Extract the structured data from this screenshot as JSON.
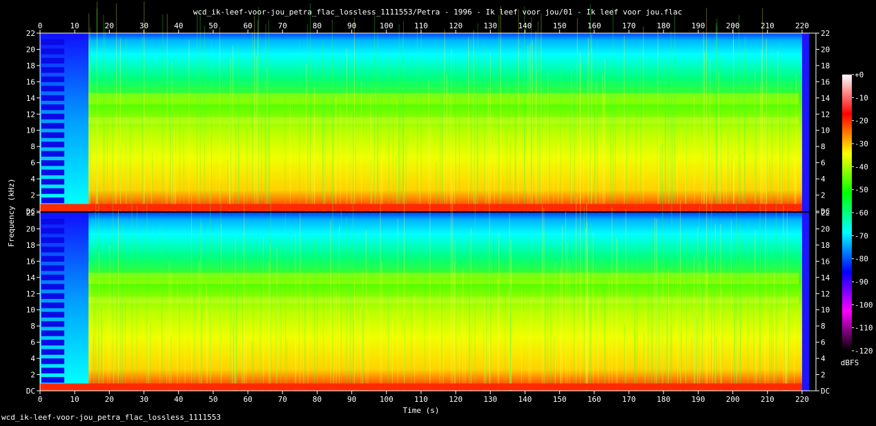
{
  "chart_data": {
    "type": "heatmap",
    "title": "wcd_ik-leef-voor-jou_petra_flac_lossless_1111553/Petra - 1996 - Ik leef voor jou/01 - Ik leef voor jou.flac",
    "xlabel": "Time (s)",
    "ylabel": "Frequency (kHz)",
    "xlim": [
      0,
      224
    ],
    "ylim": [
      0,
      22
    ],
    "x_ticks": [
      0,
      10,
      20,
      30,
      40,
      50,
      60,
      70,
      80,
      90,
      100,
      110,
      120,
      130,
      140,
      150,
      160,
      170,
      180,
      190,
      200,
      210,
      220
    ],
    "y_ticks": [
      {
        "value": 0,
        "label": "DC"
      },
      {
        "value": 2,
        "label": "2"
      },
      {
        "value": 4,
        "label": "4"
      },
      {
        "value": 6,
        "label": "6"
      },
      {
        "value": 8,
        "label": "8"
      },
      {
        "value": 10,
        "label": "10"
      },
      {
        "value": 12,
        "label": "12"
      },
      {
        "value": 14,
        "label": "14"
      },
      {
        "value": 16,
        "label": "16"
      },
      {
        "value": 18,
        "label": "18"
      },
      {
        "value": 20,
        "label": "20"
      },
      {
        "value": 22,
        "label": "22"
      }
    ],
    "channels": 2,
    "colorbar": {
      "unit": "dBFS",
      "range": [
        -120,
        0
      ],
      "ticks": [
        {
          "value": 0,
          "label": "+0"
        },
        {
          "value": -10,
          "label": "-10"
        },
        {
          "value": -20,
          "label": "-20"
        },
        {
          "value": -30,
          "label": "-30"
        },
        {
          "value": -40,
          "label": "-40"
        },
        {
          "value": -50,
          "label": "-50"
        },
        {
          "value": -60,
          "label": "-60"
        },
        {
          "value": -70,
          "label": "-70"
        },
        {
          "value": -80,
          "label": "-80"
        },
        {
          "value": -90,
          "label": "-90"
        },
        {
          "value": -100,
          "label": "-100"
        },
        {
          "value": -110,
          "label": "-110"
        },
        {
          "value": -120,
          "label": "-120"
        }
      ],
      "stops": [
        "#ffffff",
        "#ff0000",
        "#ffff00",
        "#00ff00",
        "#00ffff",
        "#0000ff",
        "#ff00ff",
        "#000000"
      ]
    }
  },
  "footer": "wcd_ik-leef-voor-jou_petra_flac_lossless_1111553"
}
